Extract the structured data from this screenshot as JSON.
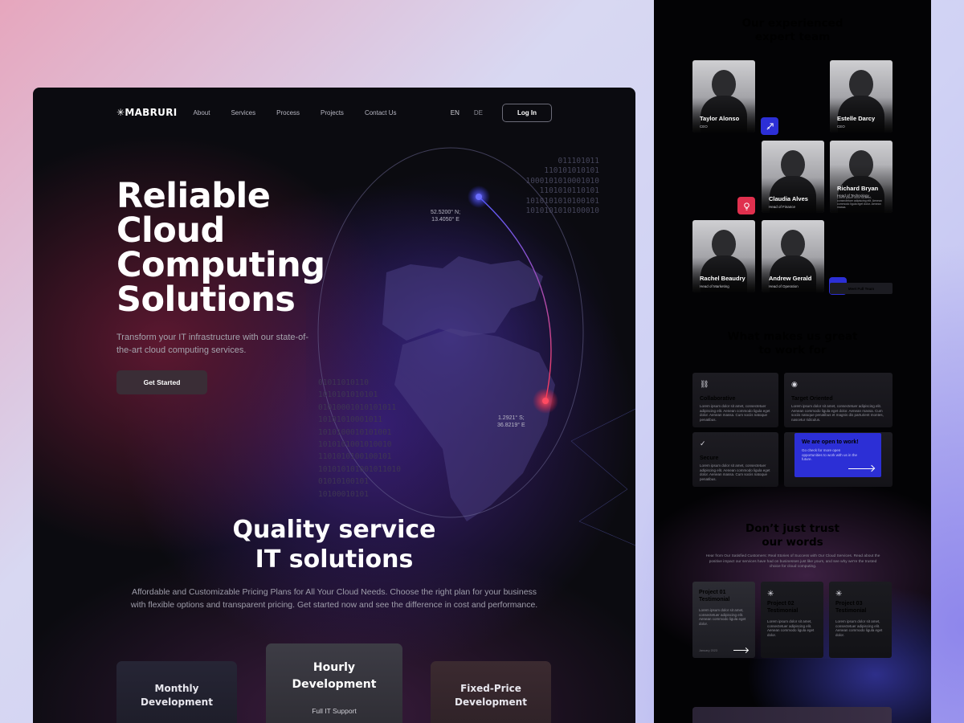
{
  "colors": {
    "accent_blue": "#2c2fd6",
    "accent_red": "#e0304e",
    "bg_dark": "#0b0b10"
  },
  "nav": {
    "logo": "✳MABRURI",
    "links": [
      "About",
      "Services",
      "Process",
      "Projects",
      "Contact Us"
    ],
    "lang_en": "EN",
    "lang_de": "DE",
    "login": "Log In"
  },
  "hero": {
    "title_lines": [
      "Reliable",
      "Cloud",
      "Computing",
      "Solutions"
    ],
    "subtitle": "Transform your IT infrastructure with our state-of-the-art cloud computing services.",
    "cta": "Get Started",
    "coord_top": [
      "52.5200° N;",
      "13.4050° E"
    ],
    "coord_bottom": [
      "1.2921° S;",
      "36.8219° E"
    ],
    "binary_top": [
      "011101011",
      "110101010101",
      "1000101010001010",
      "1101010110101",
      "1010101010100101",
      "1010101010100010"
    ],
    "binary_mid": [
      "01011010110",
      "1010101010101",
      "01010001010101011",
      "10101010001011",
      "1010100010101001",
      "1010101001010010",
      "1101010100100101",
      "101010101001011010",
      "01010100101",
      "10100010101"
    ]
  },
  "quality": {
    "title_lines": [
      "Quality service",
      "IT solutions"
    ],
    "subtitle": "Affordable and Customizable Pricing Plans for All Your Cloud Needs. Choose the right plan for your business with flexible options and transparent pricing. Get started now and see the difference in cost and performance."
  },
  "pricing": [
    {
      "name_lines": [
        "Monthly",
        "Development"
      ]
    },
    {
      "name_lines": [
        "Hourly",
        "Development"
      ],
      "note": "Full IT Support"
    },
    {
      "name_lines": [
        "Fixed-Price",
        "Development"
      ]
    }
  ],
  "team": {
    "title_lines": [
      "Our experienced",
      "expert team"
    ],
    "members": [
      {
        "name": "Taylor Alonso",
        "role": "CEO"
      },
      {
        "name": "Estelle Darcy",
        "role": "CEO"
      },
      {
        "name": "Claudia Alves",
        "role": "Head of Finance"
      },
      {
        "name": "Richard Bryan",
        "role": "Head of Technology",
        "text": "Lorem ipsum dolor sit amet, consectetuer adipiscing elit. Aenean commodo ligula eget dolor. Aenean massa."
      },
      {
        "name": "Rachel Beaudry",
        "role": "Head of Marketing"
      },
      {
        "name": "Andrew Gerald",
        "role": "Head of Operation"
      }
    ],
    "meet_button": "Meet Full Team",
    "badge_icons": [
      "rocket-icon",
      "lightbulb-icon",
      "user-icon"
    ]
  },
  "great": {
    "title_lines": [
      "What makes us great",
      "to work for"
    ],
    "features": [
      {
        "icon": "link-icon",
        "title": "Collaborative",
        "text": "Lorem ipsum dolor sit amet, consectetuer adipiscing elit. Aenean commodo ligula eget dolor. Aenean massa. Cum sociis natoque penatibus."
      },
      {
        "icon": "target-icon",
        "title": "Target Oriented",
        "text": "Lorem ipsum dolor sit amet, consectetuer adipiscing elit. Aenean commodo ligula eget dolor. Aenean massa. Cum sociis natoque penatibus et magnis dis parturient montes, nascetur ridiculus."
      },
      {
        "icon": "check-icon",
        "title": "Secure",
        "text": "Lorem ipsum dolor sit amet, consectetuer adipiscing elit. Aenean commodo ligula eget dolor. Aenean massa. Cum sociis natoque penatibus."
      }
    ],
    "open": {
      "title": "We are open to work!",
      "text": "Go check for more open opportunities to work with us in the future."
    }
  },
  "trust": {
    "title_lines": [
      "Don’t just trust",
      "our words"
    ],
    "subtitle": "Hear from Our Satisfied Customers: Real Stories of Success with Our Cloud Services. Read about the positive impact our services have had on businesses just like yours, and see why we're the trusted choice for cloud computing.",
    "projects": [
      {
        "title_lines": [
          "Project 01",
          "Testimonial"
        ],
        "text": "Lorem ipsum dolor sit amet, consectetuer adipiscing elit. Aenean commodo ligula eget dolor.",
        "date": "January 2023"
      },
      {
        "title_lines": [
          "Project 02",
          "Testimonial"
        ],
        "text": "Lorem ipsum dolor sit amet, consectetuer adipiscing elit. Aenean commodo ligula eget dolor."
      },
      {
        "title_lines": [
          "Project 03",
          "Testimonial"
        ],
        "text": "Lorem ipsum dolor sit amet, consectetuer adipiscing elit. Aenean commodo ligula eget dolor."
      }
    ]
  }
}
